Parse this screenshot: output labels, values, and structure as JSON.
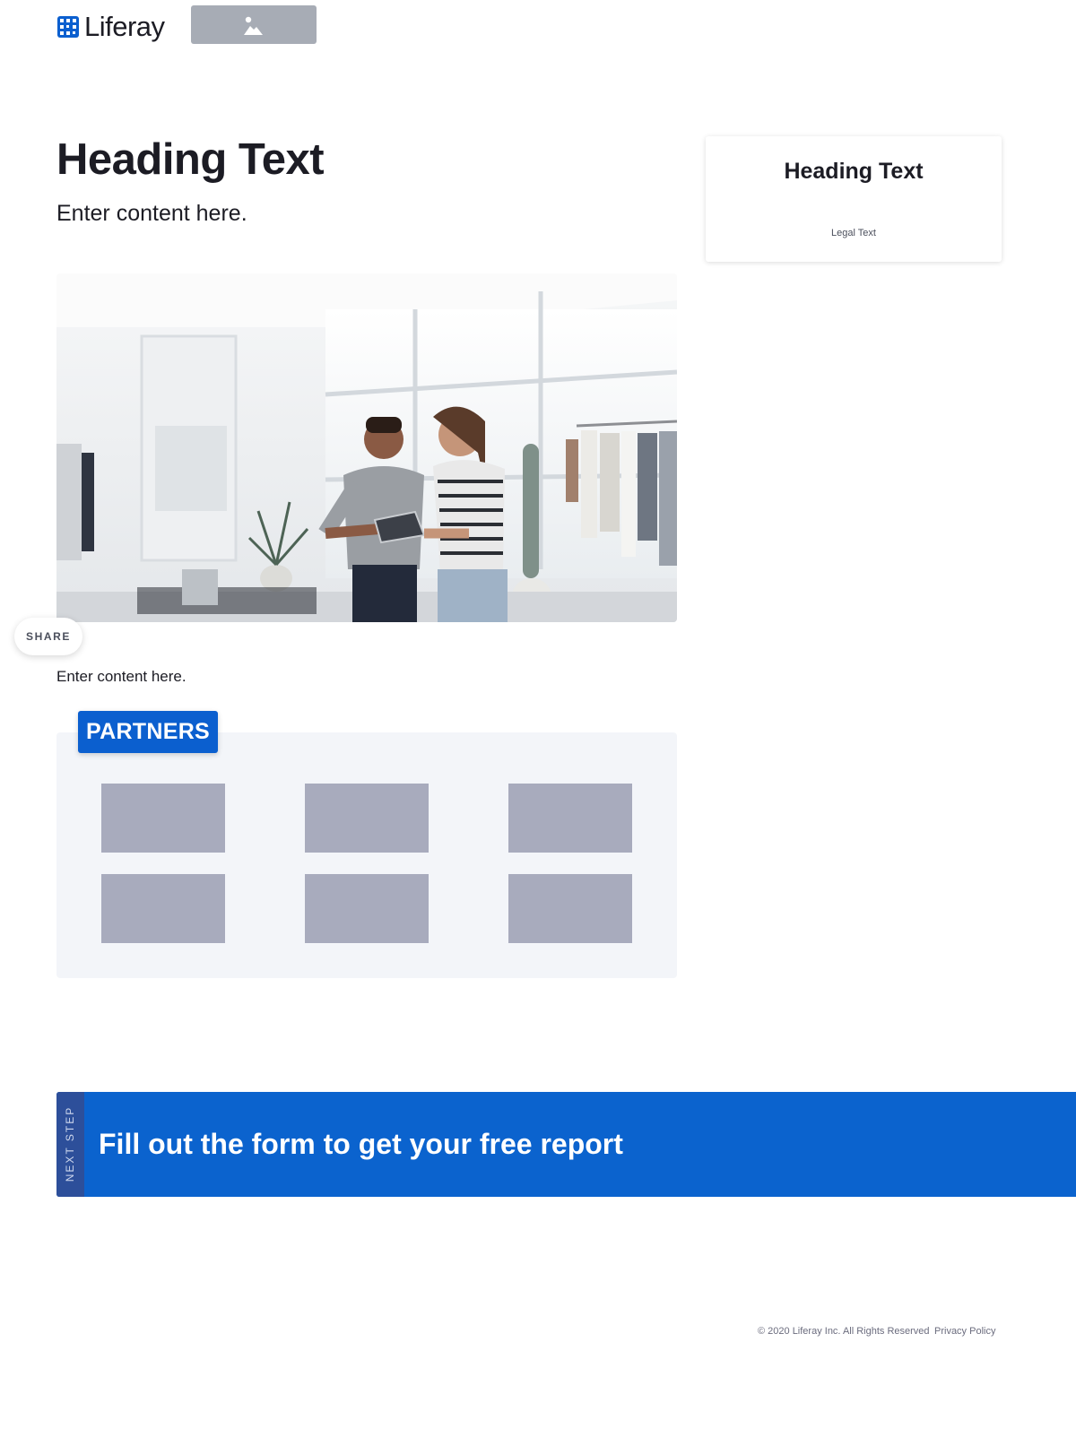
{
  "header": {
    "logo_text": "Liferay",
    "logo_icon": "liferay-logo-icon",
    "image_placeholder_icon": "image-icon"
  },
  "main": {
    "heading": "Heading Text",
    "subheading": "Enter content here.",
    "body_text": "Enter content here."
  },
  "card": {
    "heading": "Heading Text",
    "legal": "Legal Text"
  },
  "share": {
    "label": "SHARE"
  },
  "partners": {
    "label": "PARTNERS",
    "tile_count": 6
  },
  "cta": {
    "side_label": "NEXT STEP",
    "text": "Fill out the form to get your free report",
    "color": "#0b63ce"
  },
  "footer": {
    "copyright": "© 2020 Liferay Inc. All Rights Reserved",
    "privacy": "Privacy Policy"
  },
  "colors": {
    "brand": "#0b5fcf",
    "text": "#1c1c24",
    "muted": "#6b6c7e",
    "tile": "#a8abbd"
  }
}
